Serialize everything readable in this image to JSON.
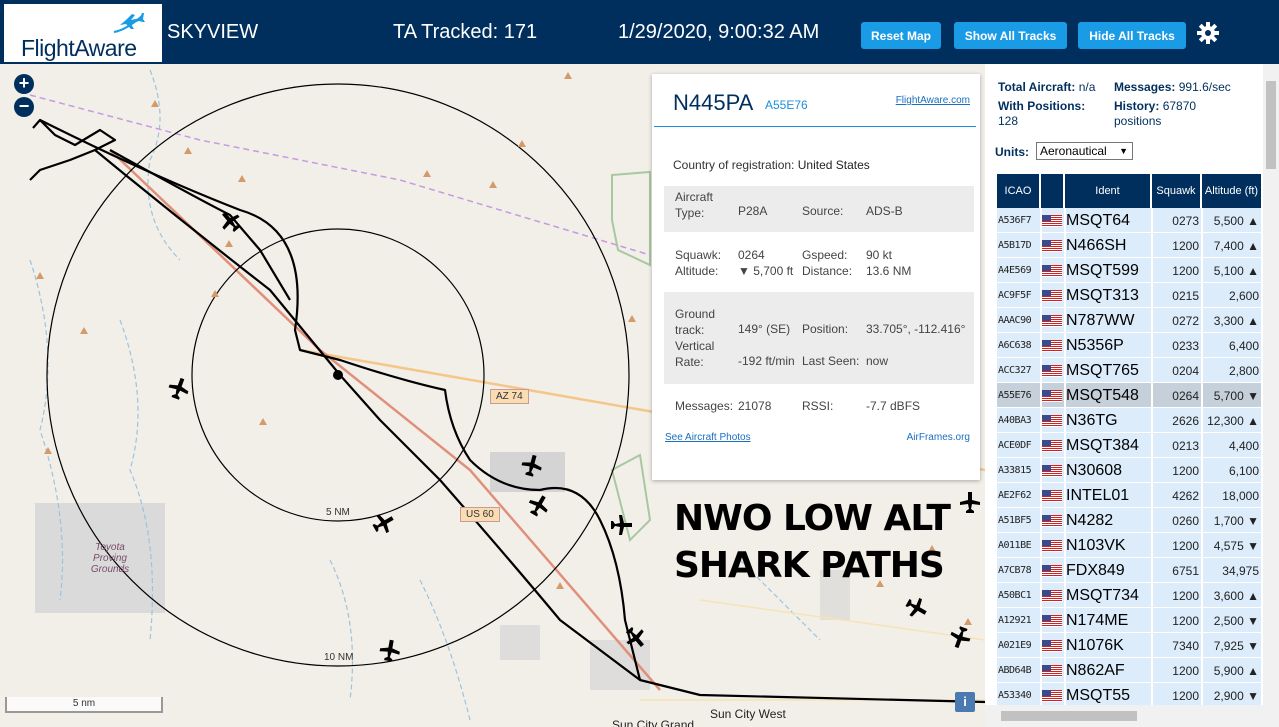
{
  "header": {
    "logo_text": "FlightAware",
    "app_name": "SKYVIEW",
    "tracked": "TA Tracked: 171",
    "datetime": "1/29/2020, 9:00:32 AM",
    "reset_map": "Reset Map",
    "show_all_tracks": "Show All Tracks",
    "hide_all_tracks": "Hide All Tracks",
    "colors": {
      "bar": "#002f5d",
      "button": "#1a9be6"
    }
  },
  "map": {
    "zoom_in": "+",
    "zoom_out": "−",
    "scale": "5 nm",
    "info": "i",
    "ring_inner": "5 NM",
    "ring_outer": "10 NM",
    "road_az74": "AZ 74",
    "road_us60": "US 60",
    "place_toyota": "Toyota Proving Grounds",
    "place_suncity_west": "Sun City West",
    "place_suncity_grand": "Sun City Grand",
    "overlay_line1": "NWO LOW ALT",
    "overlay_line2": "SHARK PATHS"
  },
  "popup": {
    "ident": "N445PA",
    "icao": "A55E76",
    "link": "FlightAware.com",
    "country_label": "Country of registration:",
    "country": "United States",
    "type_label": "Aircraft Type:",
    "type": "P28A",
    "source_label": "Source:",
    "source": "ADS-B",
    "squawk_label": "Squawk:",
    "squawk": "0264",
    "altitude_label": "Altitude:",
    "altitude": "▼ 5,700 ft",
    "gspeed_label": "Gspeed:",
    "gspeed": "90 kt",
    "distance_label": "Distance:",
    "distance": "13.6 NM",
    "track_label": "Ground track:",
    "track": "149° (SE)",
    "vrate_label": "Vertical Rate:",
    "vrate": "-192 ft/min",
    "position_label": "Position:",
    "position": "33.705°, -112.416°",
    "lastseen_label": "Last Seen:",
    "lastseen": "now",
    "messages_label": "Messages:",
    "messages": "21078",
    "rssi_label": "RSSI:",
    "rssi": "-7.7 dBFS",
    "photos_link": "See Aircraft Photos",
    "airframes_link": "AirFrames.org"
  },
  "panel": {
    "total_label": "Total Aircraft:",
    "total": "n/a",
    "messages_label": "Messages:",
    "messages": "991.6/sec",
    "withpos_label": "With Positions:",
    "withpos": "128",
    "history_label": "History:",
    "history": "67870",
    "history_unit": "positions",
    "units_label": "Units:",
    "units_value": "Aeronautical",
    "columns": {
      "icao": "ICAO",
      "ident": "Ident",
      "squawk": "Squawk",
      "altitude": "Altitude (ft)"
    },
    "rows": [
      {
        "icao": "A536F7",
        "ident": "MSQT64",
        "squawk": "0273",
        "alt": "5,500 ▲"
      },
      {
        "icao": "A5B17D",
        "ident": "N466SH",
        "squawk": "1200",
        "alt": "7,400 ▲"
      },
      {
        "icao": "A4E569",
        "ident": "MSQT599",
        "squawk": "1200",
        "alt": "5,100 ▲"
      },
      {
        "icao": "AC9F5F",
        "ident": "MSQT313",
        "squawk": "0215",
        "alt": "2,600"
      },
      {
        "icao": "AAAC90",
        "ident": "N787WW",
        "squawk": "0272",
        "alt": "3,300 ▲"
      },
      {
        "icao": "A6C638",
        "ident": "N5356P",
        "squawk": "0233",
        "alt": "6,400"
      },
      {
        "icao": "ACC327",
        "ident": "MSQT765",
        "squawk": "0204",
        "alt": "2,800"
      },
      {
        "icao": "A55E76",
        "ident": "MSQT548",
        "squawk": "0264",
        "alt": "5,700 ▼"
      },
      {
        "icao": "A40BA3",
        "ident": "N36TG",
        "squawk": "2626",
        "alt": "12,300 ▲"
      },
      {
        "icao": "ACE0DF",
        "ident": "MSQT384",
        "squawk": "0213",
        "alt": "4,400"
      },
      {
        "icao": "A33815",
        "ident": "N30608",
        "squawk": "1200",
        "alt": "6,100"
      },
      {
        "icao": "AE2F62",
        "ident": "INTEL01",
        "squawk": "4262",
        "alt": "18,000"
      },
      {
        "icao": "A51BF5",
        "ident": "N4282",
        "squawk": "0260",
        "alt": "1,700 ▼"
      },
      {
        "icao": "A011BE",
        "ident": "N103VK",
        "squawk": "1200",
        "alt": "4,575 ▼"
      },
      {
        "icao": "A7CB78",
        "ident": "FDX849",
        "squawk": "6751",
        "alt": "34,975"
      },
      {
        "icao": "A50BC1",
        "ident": "MSQT734",
        "squawk": "1200",
        "alt": "3,600 ▲"
      },
      {
        "icao": "A12921",
        "ident": "N174ME",
        "squawk": "1200",
        "alt": "2,500 ▼"
      },
      {
        "icao": "A021E9",
        "ident": "N1076K",
        "squawk": "7340",
        "alt": "7,925 ▼"
      },
      {
        "icao": "ABD64B",
        "ident": "N862AF",
        "squawk": "1200",
        "alt": "5,900 ▲"
      },
      {
        "icao": "A53340",
        "ident": "MSQT55",
        "squawk": "1200",
        "alt": "2,900 ▼"
      }
    ],
    "selected_icao": "A55E76"
  }
}
